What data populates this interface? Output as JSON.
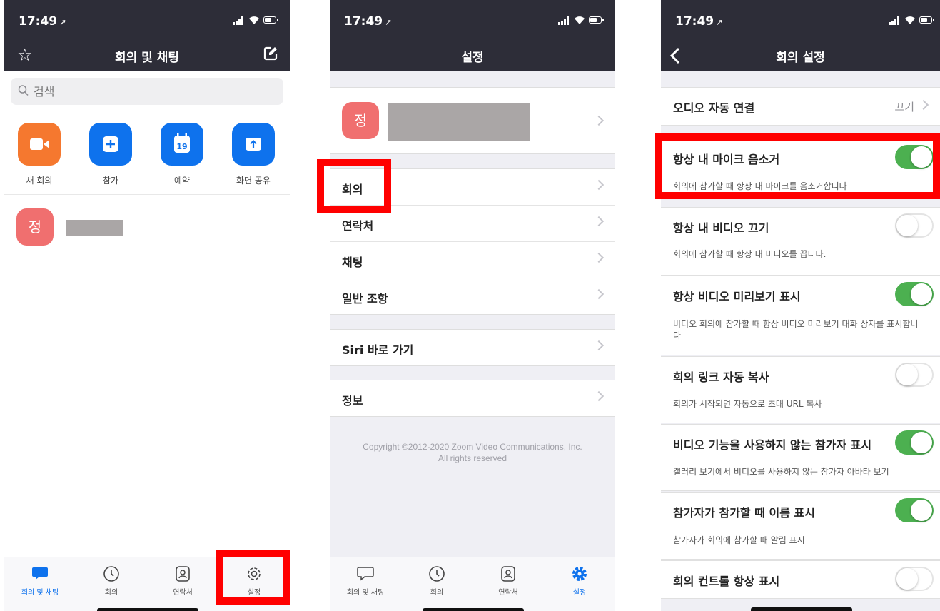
{
  "status": {
    "time": "17:49",
    "location_glyph": "➚"
  },
  "screen1": {
    "title": "회의 및 채팅",
    "search_placeholder": "검색",
    "actions": [
      {
        "label": "새 회의",
        "color": "#f5782f",
        "icon": "video-camera-icon"
      },
      {
        "label": "참가",
        "color": "#0e72ed",
        "icon": "plus-icon"
      },
      {
        "label": "예약",
        "color": "#0e72ed",
        "icon": "calendar-icon",
        "calendar_day": "19"
      },
      {
        "label": "화면 공유",
        "color": "#0e72ed",
        "icon": "share-screen-icon"
      }
    ],
    "recent_avatar": "정"
  },
  "tabs": [
    {
      "label": "회의 및 채팅",
      "icon": "chat-icon"
    },
    {
      "label": "회의",
      "icon": "clock-icon"
    },
    {
      "label": "연락처",
      "icon": "contact-icon"
    },
    {
      "label": "설정",
      "icon": "gear-icon"
    }
  ],
  "screen2": {
    "title": "설정",
    "profile_avatar": "정",
    "menu": [
      "회의",
      "연락처",
      "채팅",
      "일반 조항"
    ],
    "siri": "Siri 바로 가기",
    "info": "정보",
    "copyright_line1": "Copyright ©2012-2020 Zoom Video Communications, Inc.",
    "copyright_line2": "All rights reserved"
  },
  "screen3": {
    "title": "회의 설정",
    "audio_label": "오디오 자동 연결",
    "audio_value": "끄기",
    "settings": [
      {
        "title": "항상 내 마이크 음소거",
        "desc": "회의에 참가할 때 항상 내 마이크를 음소거합니다",
        "on": true
      },
      {
        "title": "항상 내 비디오 끄기",
        "desc": "회의에 참가할 때 항상 내 비디오를 끕니다.",
        "on": false
      },
      {
        "title": "항상 비디오 미리보기 표시",
        "desc": "비디오 회의에 참가할 때 항상 비디오 미리보기 대화 상자를 표시합니다",
        "on": true
      },
      {
        "title": "회의 링크 자동 복사",
        "desc": "회의가 시작되면 자동으로 초대 URL 복사",
        "on": false
      },
      {
        "title": "비디오 기능을 사용하지 않는 참가자 표시",
        "desc": "갤러리 보기에서 비디오를 사용하지 않는 참가자 아바타 보기",
        "on": true
      },
      {
        "title": "참가자가 참가할 때 이름 표시",
        "desc": "참가자가 회의에 참가할 때 알림 표시",
        "on": true
      },
      {
        "title": "회의 컨트롤 항상 표시",
        "on": false
      }
    ]
  },
  "colors": {
    "accent": "#0e72ed",
    "toggle_on": "#4cb050",
    "highlight": "#ff0000",
    "header": "#2d2d38"
  }
}
